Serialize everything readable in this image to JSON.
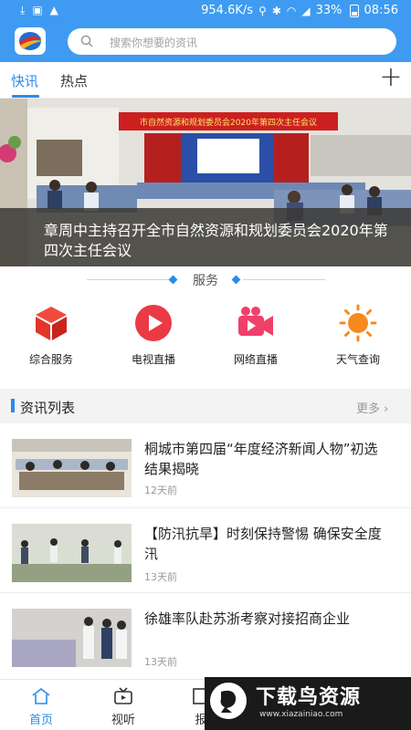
{
  "status_bar": {
    "speed": "954.6K/s",
    "battery": "33%",
    "time": "08:56"
  },
  "search": {
    "placeholder": "搜索你想要的资讯"
  },
  "tabs": [
    {
      "label": "快讯",
      "active": true
    },
    {
      "label": "热点",
      "active": false
    }
  ],
  "add_tab_label": "+",
  "banner": {
    "caption": "章周中主持召开全市自然资源和规划委员会2020年第四次主任会议",
    "sign_text": "市自然资源和规划委员会2020年第四次主任会议",
    "dot_count": 10,
    "active_dot": 3
  },
  "services": {
    "title": "服务",
    "items": [
      {
        "label": "综合服务",
        "icon": "cube-icon",
        "color": "#e8352d"
      },
      {
        "label": "电视直播",
        "icon": "play-icon",
        "color": "#e8352d"
      },
      {
        "label": "网络直播",
        "icon": "video-camera-icon",
        "color": "#f0406a"
      },
      {
        "label": "天气查询",
        "icon": "sun-icon",
        "color": "#f7891f"
      }
    ]
  },
  "news": {
    "title": "资讯列表",
    "more_label": "更多",
    "items": [
      {
        "title": "桐城市第四届“年度经济新闻人物”初选结果揭晓",
        "time": "12天前"
      },
      {
        "title": "【防汛抗旱】时刻保持警惕 确保安全度汛",
        "time": "13天前"
      },
      {
        "title": "徐雄率队赴苏浙考察对接招商企业",
        "time": "13天前"
      }
    ]
  },
  "bottom_nav": [
    {
      "label": "首页",
      "icon": "home-icon",
      "active": true
    },
    {
      "label": "视听",
      "icon": "tv-icon",
      "active": false
    },
    {
      "label": "报",
      "icon": "newspaper-icon",
      "active": false
    }
  ],
  "watermark": {
    "title": "下载鸟资源",
    "url": "www.xiazainiao.com"
  },
  "colors": {
    "brand_blue": "#3e9bf1",
    "accent_blue": "#2a8bea"
  }
}
